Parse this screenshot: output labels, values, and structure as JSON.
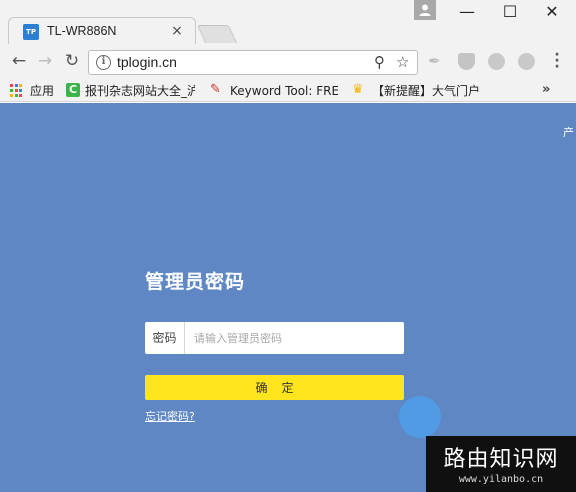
{
  "tab": {
    "favicon_text": "TP",
    "title": "TL-WR886N",
    "close_glyph": "×"
  },
  "window_controls": {
    "minimize": "—",
    "maximize": "☐",
    "close": "✕"
  },
  "toolbar": {
    "back_glyph": "←",
    "forward_glyph": "→",
    "reload_glyph": "↻",
    "url": "tplogin.cn",
    "zoom_glyph": "⚲",
    "star_glyph": "☆",
    "extensions": [
      "feather-extension-icon",
      "shield-extension-icon",
      "circle-extension-icon",
      "circle-extension-icon"
    ]
  },
  "bookmarks": {
    "items": [
      {
        "label": "应用",
        "icon": "apps-grid-icon"
      },
      {
        "label": "报刊杂志网站大全_沪",
        "icon": "green-c-icon",
        "icon_color": "#3ab54a"
      },
      {
        "label": "Keyword Tool: FREE",
        "icon": "keyword-tool-icon",
        "icon_color": "#e05a2a"
      },
      {
        "label": "【新提醒】大气门户",
        "icon": "trophy-icon",
        "icon_color": "#f2b600"
      }
    ],
    "more": "»"
  },
  "page": {
    "corner_label": "产",
    "title": "管理员密码",
    "password_label": "密码",
    "password_placeholder": "请输入管理员密码",
    "confirm_label": "确定",
    "forgot_label": "忘记密码?",
    "background_color": "#5e87c4",
    "button_color": "#ffe51e"
  },
  "watermark": {
    "title": "路由知识网",
    "url": "www.yilanbo.cn"
  }
}
